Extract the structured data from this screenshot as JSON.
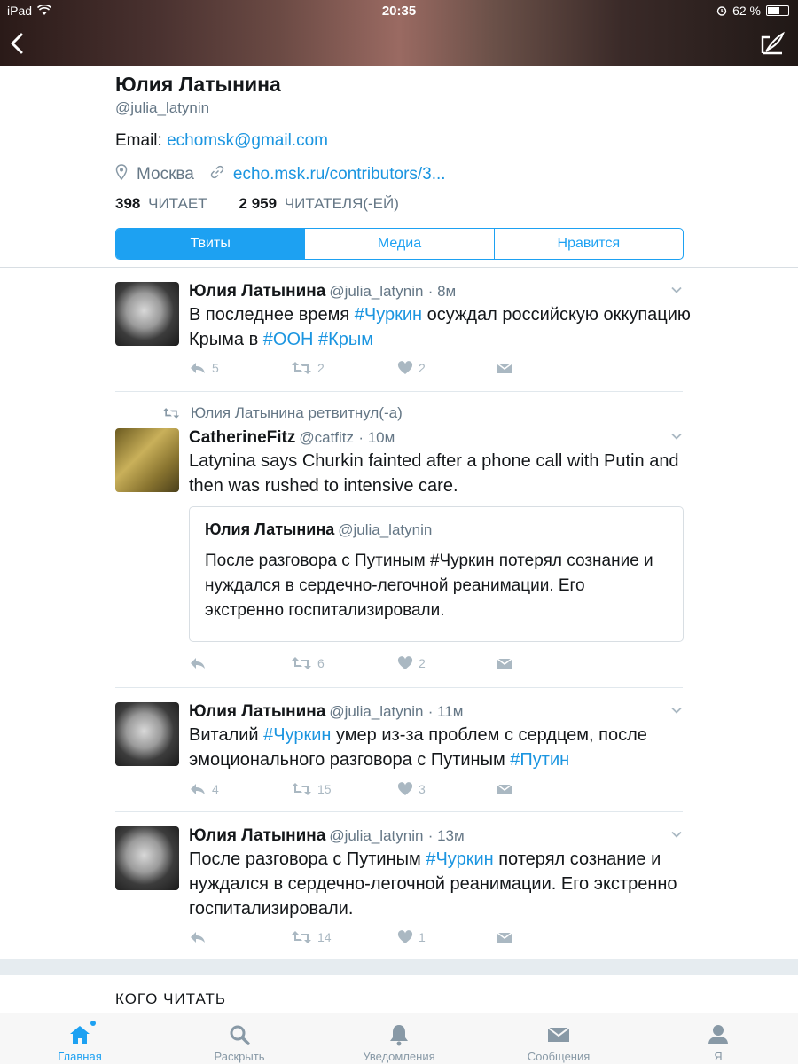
{
  "status_bar": {
    "device": "iPad",
    "time": "20:35",
    "battery": "62 %",
    "battery_level": 0.62
  },
  "profile": {
    "name": "Юлия Латынина",
    "handle": "@julia_latynin",
    "email_label": "Email: ",
    "email": "echomsk@gmail.com",
    "location": "Москва",
    "url": "echo.msk.ru/contributors/3...",
    "following_count": "398",
    "following_label": "ЧИТАЕТ",
    "followers_count": "2 959",
    "followers_label": "ЧИТАТЕЛЯ(-ЕЙ)"
  },
  "tabs": [
    "Твиты",
    "Медиа",
    "Нравится"
  ],
  "tweets": [
    {
      "name": "Юлия Латынина",
      "handle": "@julia_latynin",
      "time": "· 8м",
      "parts": [
        "В последнее время ",
        "#Чуркин",
        " осуждал российскую оккупацию Крыма в ",
        "#ООН",
        " ",
        "#Крым"
      ],
      "replies": "5",
      "retweets": "2",
      "likes": "2"
    },
    {
      "retweeted_by": "Юлия Латынина ретвитнул(-а)",
      "name": "CatherineFitz",
      "handle": "@catfitz",
      "time": "· 10м",
      "text": "Latynina says Churkin fainted after a phone call with Putin and then was rushed to intensive care.",
      "quote": {
        "name": "Юлия Латынина",
        "handle": "@julia_latynin",
        "text": "После разговора с Путиным #Чуркин потерял сознание и нуждался в сердечно-легочной реанимации. Его экстренно госпитализировали."
      },
      "replies": "",
      "retweets": "6",
      "likes": "2"
    },
    {
      "name": "Юлия Латынина",
      "handle": "@julia_latynin",
      "time": "· 11м",
      "parts": [
        "Виталий ",
        "#Чуркин",
        " умер из-за проблем с сердцем, после эмоционального разговора с Путиным ",
        "#Путин"
      ],
      "replies": "4",
      "retweets": "15",
      "likes": "3"
    },
    {
      "name": "Юлия Латынина",
      "handle": "@julia_latynin",
      "time": "· 13м",
      "parts": [
        "После разговора с Путиным ",
        "#Чуркин",
        " потерял сознание и нуждался в сердечно-легочной реанимации. Его экстренно госпитализировали."
      ],
      "replies": "",
      "retweets": "14",
      "likes": "1"
    }
  ],
  "who_to_follow": "КОГО ЧИТАТЬ",
  "tabbar": [
    "Главная",
    "Раскрыть",
    "Уведомления",
    "Сообщения",
    "Я"
  ],
  "colors": {
    "accent": "#1da1f2",
    "link": "#1b95e0",
    "muted": "#657786",
    "icon": "#aab8c2"
  }
}
